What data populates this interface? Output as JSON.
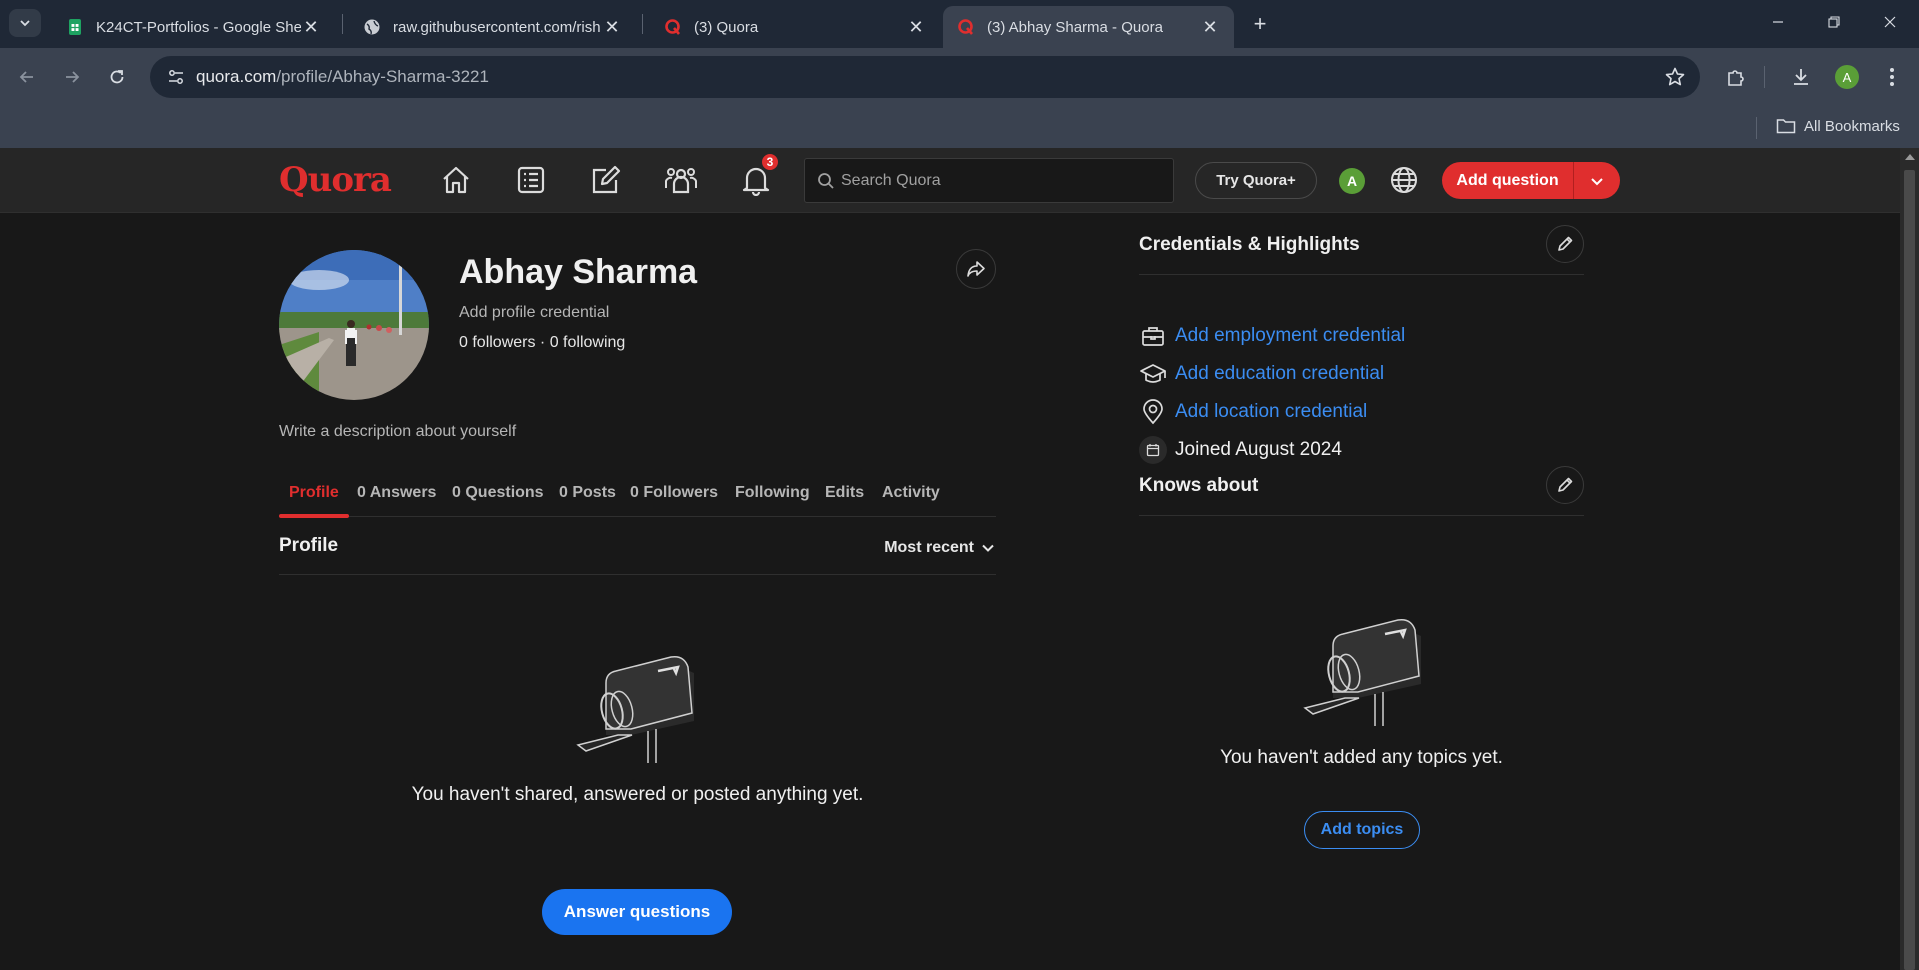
{
  "browser": {
    "tabs": [
      {
        "title": "K24CT-Portfolios - Google Shee",
        "icon": "google-sheets-icon"
      },
      {
        "title": "raw.githubusercontent.com/rish",
        "icon": "globe-icon"
      },
      {
        "title": "(3) Quora",
        "icon": "quora-icon"
      },
      {
        "title": "(3) Abhay Sharma - Quora",
        "icon": "quora-icon",
        "active": true
      }
    ],
    "url_host": "quora.com",
    "url_path": "/profile/Abhay-Sharma-3221",
    "profile_initial": "A",
    "all_bookmarks": "All Bookmarks"
  },
  "header": {
    "logo": "Quora",
    "notification_count": "3",
    "search_placeholder": "Search Quora",
    "try_quora_plus": "Try Quora+",
    "user_initial": "A",
    "add_question": "Add question"
  },
  "profile": {
    "name": "Abhay Sharma",
    "credential_prompt": "Add profile credential",
    "followers_following": "0 followers · 0 following",
    "description_prompt": "Write a description about yourself",
    "tabs": [
      "Profile",
      "0 Answers",
      "0 Questions",
      "0 Posts",
      "0 Followers",
      "Following",
      "Edits",
      "Activity"
    ],
    "section_title": "Profile",
    "sort_label": "Most recent",
    "empty_message": "You haven't shared, answered or posted anything yet.",
    "answer_button": "Answer questions"
  },
  "sidebar": {
    "credentials_title": "Credentials & Highlights",
    "credentials": [
      {
        "label": "Add employment credential",
        "icon": "briefcase-icon"
      },
      {
        "label": "Add education credential",
        "icon": "graduation-cap-icon"
      },
      {
        "label": "Add location credential",
        "icon": "location-pin-icon"
      },
      {
        "label": "Joined August 2024",
        "icon": "calendar-icon"
      }
    ],
    "knows_about_title": "Knows about",
    "topics_empty": "You haven't added any topics yet.",
    "add_topics": "Add topics"
  },
  "colors": {
    "quora_red": "#e02e2e",
    "link_blue": "#3b8df2",
    "button_blue": "#1a74f0",
    "background": "#181818"
  }
}
